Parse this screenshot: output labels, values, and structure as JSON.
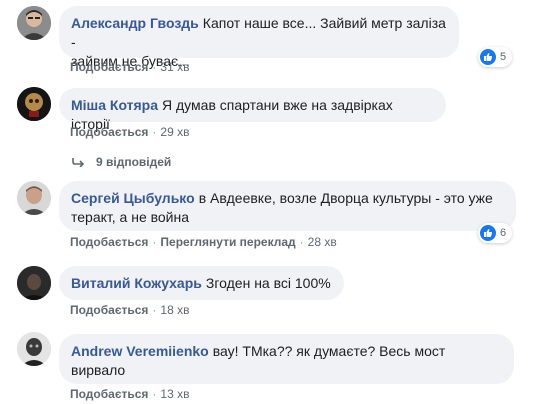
{
  "colors": {
    "bubble": "#f0f2f5",
    "author": "#385898",
    "meta": "#606770",
    "like": "#1877f2"
  },
  "comments": [
    {
      "author": "Александр Гвоздь",
      "text_line1": "Капот наше все... Зайвий метр заліза -",
      "text_line2": "зайвим не буває...",
      "like": "Подобається",
      "time": "31 хв",
      "reactions": "5",
      "reaction_icon": "like-thumb-icon"
    },
    {
      "author": "Міша Котяра",
      "text_line1": "Я думав спартани вже на задвірках історії",
      "like": "Подобається",
      "time": "29 хв",
      "replies": "9 відповідей",
      "replies_icon": "reply-arrow-icon"
    },
    {
      "author": "Сергей Цыбулько",
      "text_line1": "в Авдеевке, возле Дворца культуры - это уже",
      "text_line2": "теракт, а не война",
      "like": "Подобається",
      "translate": "Переглянути переклад",
      "time": "28 хв",
      "reactions": "6",
      "reaction_icon": "like-thumb-icon"
    },
    {
      "author": "Виталий Кожухарь",
      "text_line1": "Згоден на всі 100%",
      "like": "Подобається",
      "time": "18 хв"
    },
    {
      "author": "Andrew Veremiienko",
      "text_line1": "вау! ТМка?? як думаєте? Весь мост",
      "text_line2": "вирвало",
      "like": "Подобається",
      "time": "13 хв"
    }
  ]
}
